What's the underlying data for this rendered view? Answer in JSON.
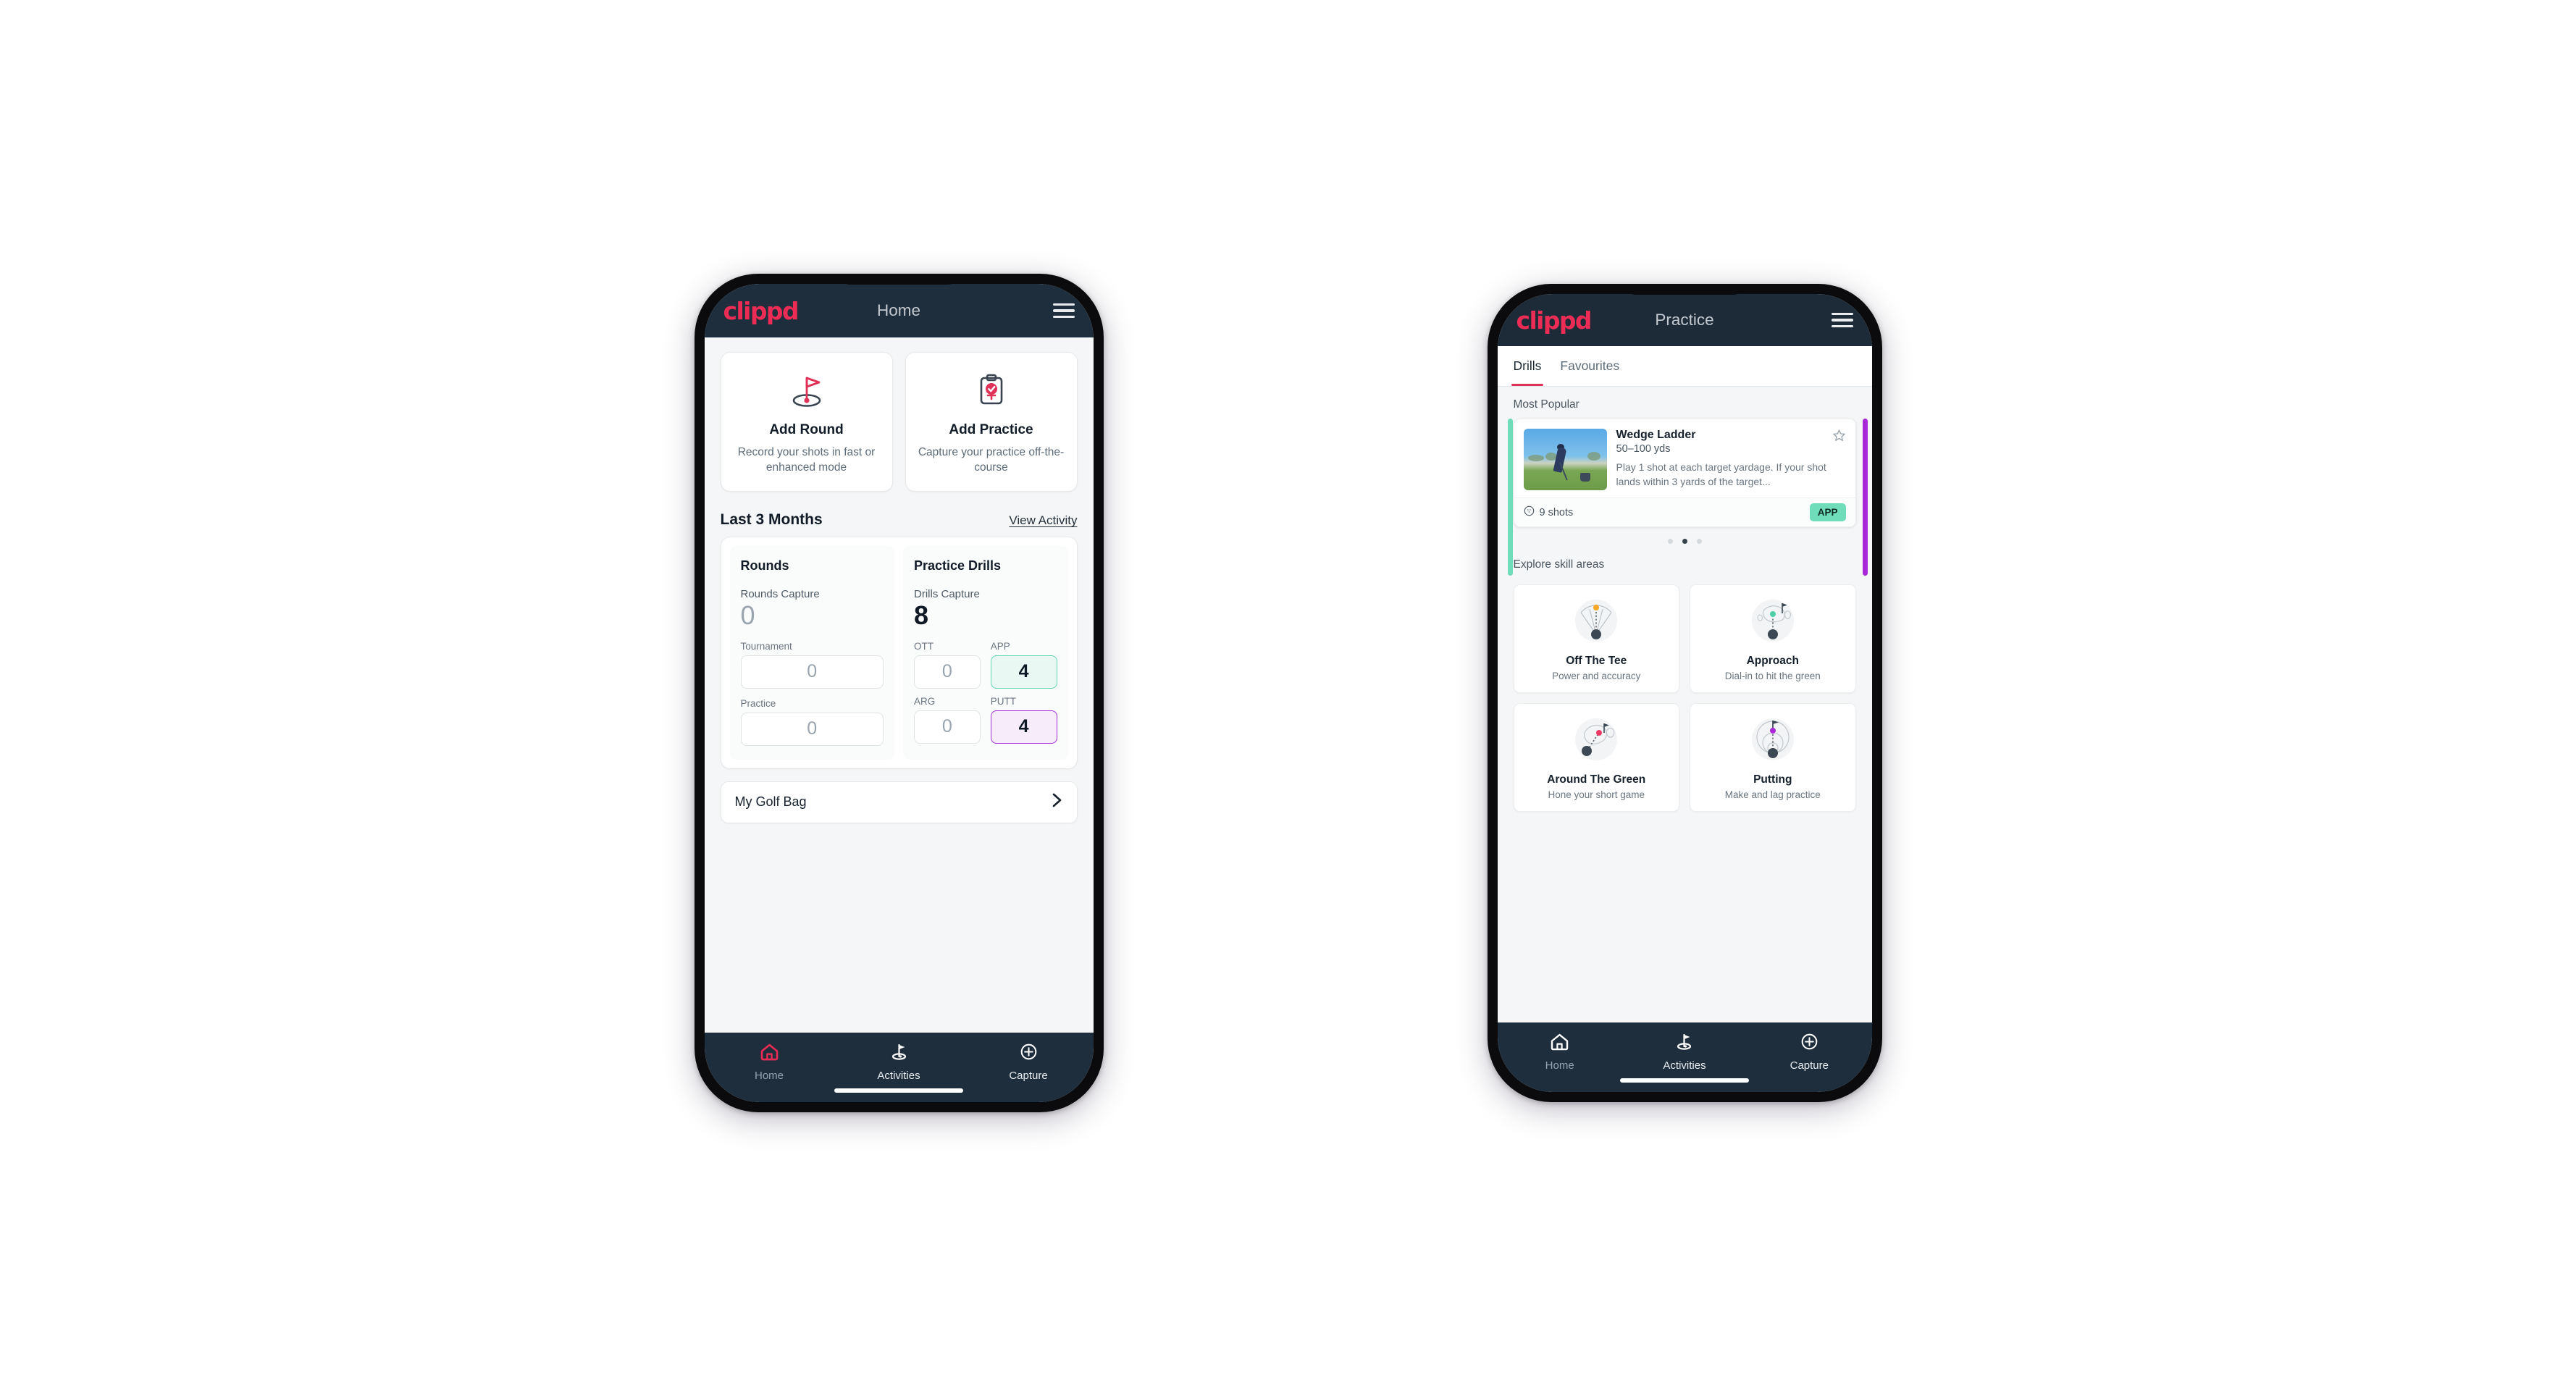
{
  "brand": {
    "logo_text": "clippd",
    "accent": "#ec2c54",
    "dark": "#1e2e3d"
  },
  "phone1": {
    "header": {
      "title": "Home",
      "menu_icon": "hamburger-menu-icon"
    },
    "action_cards": [
      {
        "icon": "golf-flag-icon",
        "title": "Add Round",
        "desc": "Record your shots in fast or enhanced mode"
      },
      {
        "icon": "clipboard-check-icon",
        "title": "Add Practice",
        "desc": "Capture your practice off-the-course"
      }
    ],
    "section": {
      "title": "Last 3 Months",
      "link": "View Activity"
    },
    "rounds_panel": {
      "title": "Rounds",
      "capture_label": "Rounds Capture",
      "capture_value": "0",
      "fields": [
        {
          "label": "Tournament",
          "value": "0"
        },
        {
          "label": "Practice",
          "value": "0"
        }
      ]
    },
    "drills_panel": {
      "title": "Practice Drills",
      "capture_label": "Drills Capture",
      "capture_value": "8",
      "stats": [
        {
          "label": "OTT",
          "value": "0",
          "highlight": "none"
        },
        {
          "label": "APP",
          "value": "4",
          "highlight": "green"
        },
        {
          "label": "ARG",
          "value": "0",
          "highlight": "none"
        },
        {
          "label": "PUTT",
          "value": "4",
          "highlight": "purple"
        }
      ]
    },
    "golf_bag": {
      "label": "My Golf Bag",
      "chevron": "chevron-right-icon"
    },
    "nav": [
      {
        "icon": "home-icon",
        "label": "Home",
        "active": true
      },
      {
        "icon": "golf-flag-hole-icon",
        "label": "Activities",
        "active": false
      },
      {
        "icon": "plus-circle-icon",
        "label": "Capture",
        "active": false
      }
    ]
  },
  "phone2": {
    "header": {
      "title": "Practice",
      "menu_icon": "hamburger-menu-icon"
    },
    "tabs": [
      {
        "label": "Drills",
        "active": true
      },
      {
        "label": "Favourites",
        "active": false
      }
    ],
    "most_popular_label": "Most Popular",
    "drill": {
      "title": "Wedge Ladder",
      "subtitle": "50–100 yds",
      "description": "Play 1 shot at each target yardage. If your shot lands within 3 yards of the target...",
      "shots": "9 shots",
      "badge": "APP",
      "badge_color": "#6fdcba",
      "star_icon": "star-outline-icon",
      "shots_icon": "golf-ball-icon",
      "strip_left_color": "#6fdcba",
      "strip_right_color": "#a929d8"
    },
    "carousel_dots": {
      "count": 3,
      "active_index": 1
    },
    "skill_label": "Explore skill areas",
    "skills": [
      {
        "icon": "tee-fan-icon",
        "name": "Off The Tee",
        "desc": "Power and accuracy",
        "accent": "#f5a623"
      },
      {
        "icon": "green-approach-icon",
        "name": "Approach",
        "desc": "Dial-in to hit the green",
        "accent": "#4ecfa8"
      },
      {
        "icon": "chip-green-icon",
        "name": "Around The Green",
        "desc": "Hone your short game",
        "accent": "#ef3a63"
      },
      {
        "icon": "putting-rings-icon",
        "name": "Putting",
        "desc": "Make and lag practice",
        "accent": "#a929d8"
      }
    ],
    "nav": [
      {
        "icon": "home-icon",
        "label": "Home",
        "active": false
      },
      {
        "icon": "golf-flag-hole-icon",
        "label": "Activities",
        "active": true
      },
      {
        "icon": "plus-circle-icon",
        "label": "Capture",
        "active": false
      }
    ]
  }
}
